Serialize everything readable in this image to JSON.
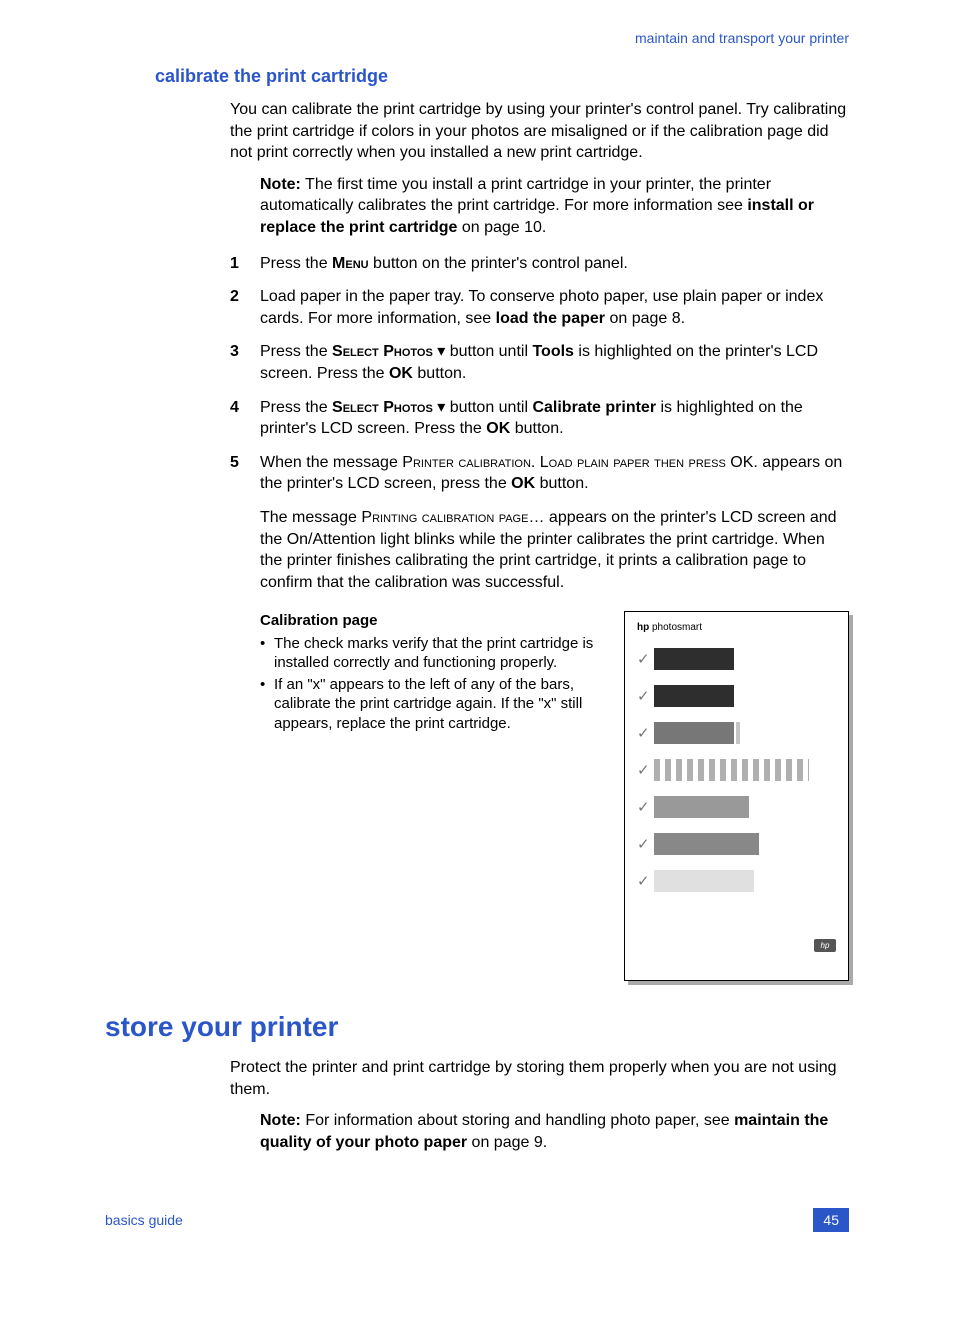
{
  "header": {
    "right": "maintain and transport your printer"
  },
  "subhead1": "calibrate the print cartridge",
  "intro": "You can calibrate the print cartridge by using your printer's control panel. Try calibrating the print cartridge if colors in your photos are misaligned or if the calibration page did not print correctly when you installed a new print cartridge.",
  "note1": {
    "label": "Note:",
    "body1": " The first time you install a print cartridge in your printer, the printer automatically calibrates the print cartridge. For more information see ",
    "bold1": "install or replace the print cartridge",
    "body2": " on page 10."
  },
  "steps": {
    "1": {
      "pre": "Press the ",
      "btn": "Menu",
      "post": " button on the printer's control panel."
    },
    "2": {
      "pre": "Load paper in the paper tray. To conserve photo paper, use plain paper or index cards. For more information, see ",
      "bold": "load the paper",
      "post": " on page 8."
    },
    "3": {
      "pre": "Press the ",
      "btn": "Select Photos",
      "mid": " button until ",
      "bold": "Tools",
      "post1": " is highlighted on the printer's LCD screen. Press the ",
      "ok": "OK",
      "post2": " button."
    },
    "4": {
      "pre": "Press the ",
      "btn": "Select Photos",
      "mid": " button until ",
      "bold": "Calibrate printer",
      "post1": " is highlighted on the printer's LCD screen. Press the ",
      "ok": "OK",
      "post2": " button."
    },
    "5": {
      "pre": "When the message ",
      "msg1": "Printer calibration. Load plain paper then press ",
      "ok1": "OK.",
      "mid": " appears on the printer's LCD screen, press the ",
      "ok2": "OK",
      "post": " button."
    }
  },
  "result": {
    "pre": "The message ",
    "msg": "Printing calibration page…",
    "post": " appears on the printer's LCD screen and the On/Attention light blinks while the printer calibrates the print cartridge. When the printer finishes calibrating the print cartridge, it prints a calibration page to confirm that the calibration was successful."
  },
  "cal": {
    "title": "Calibration page",
    "b1": "The check marks verify that the print cartridge is installed correctly and functioning properly.",
    "b2": "If an \"x\" appears to the left of any of the bars, calibrate the print cartridge again. If the \"x\" still appears, replace the print cartridge.",
    "brand_bold": "hp",
    "brand_rest": " photosmart"
  },
  "section2": {
    "head": "store your printer",
    "intro": "Protect the printer and print cartridge by storing them properly when you are not using them.",
    "note": {
      "label": "Note:",
      "body1": " For information about storing and handling photo paper, see ",
      "bold": "maintain the quality of your photo paper",
      "body2": " on page 9."
    }
  },
  "footer": {
    "left": "basics guide",
    "page": "45"
  }
}
